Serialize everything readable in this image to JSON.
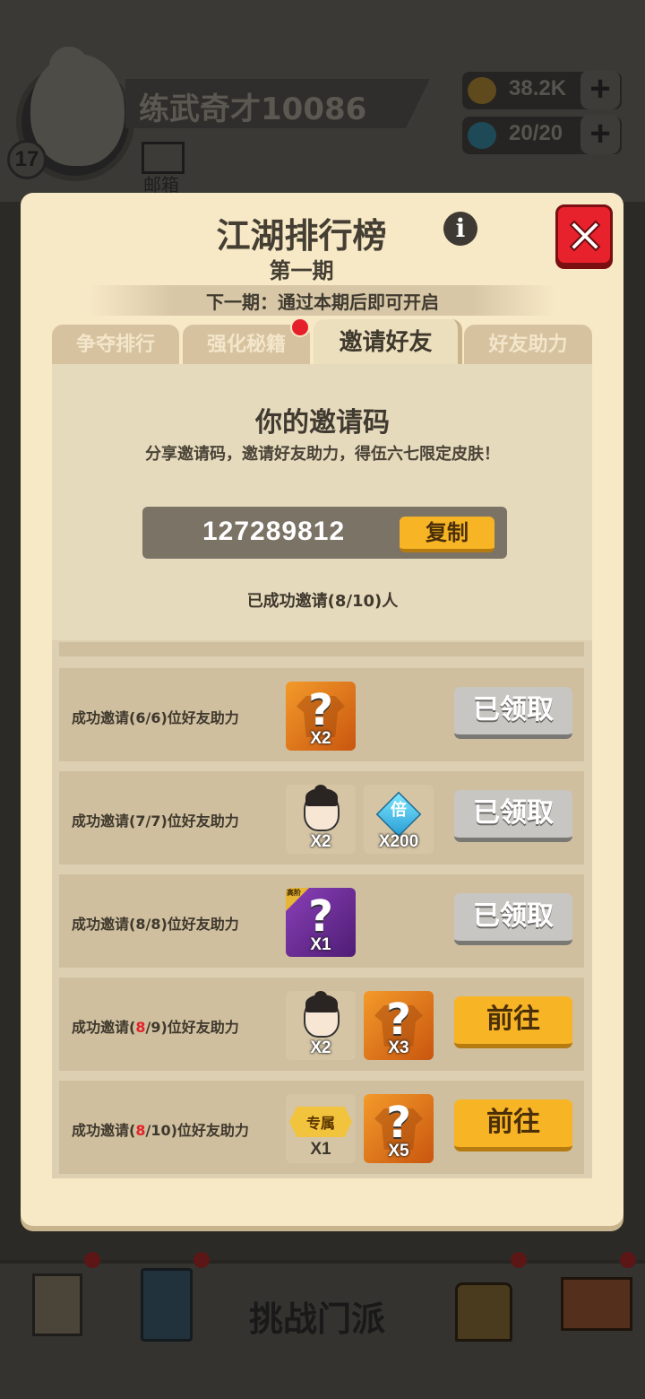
{
  "background": {
    "level": "17",
    "player_name": "练武奇才10086",
    "mail_label": "邮箱",
    "gold": "38.2K",
    "energy": "20/20",
    "plus_symbol": "+",
    "bottom_nav": {
      "challenge_label": "挑战门派"
    }
  },
  "modal": {
    "title": "江湖排行榜",
    "subtitle": "第一期",
    "period_note": "下一期：通过本期后即可开启",
    "tabs": [
      {
        "label": "争夺排行",
        "active": false
      },
      {
        "label": "强化秘籍",
        "active": false
      },
      {
        "label": "邀请好友",
        "active": true
      },
      {
        "label": "好友助力",
        "active": false
      }
    ],
    "invite": {
      "heading": "你的邀请码",
      "description": "分享邀请码，邀请好友助力，得伍六七限定皮肤！",
      "code": "127289812",
      "copy_label": "复制",
      "invited_status": "已成功邀请(8/10)人"
    },
    "rows": [
      {
        "text_prefix": "成功邀请(",
        "progress": "6",
        "text_mid": "/6)位好友助力",
        "rewards": [
          {
            "type": "mystery-outfit",
            "qty": "X2"
          }
        ],
        "button": "已领取",
        "state": "claimed"
      },
      {
        "text_prefix": "成功邀请(",
        "progress": "7",
        "text_mid": "/7)位好友助力",
        "rewards": [
          {
            "type": "character-head",
            "qty": "X2"
          },
          {
            "type": "gem",
            "char": "倍",
            "qty": "X200"
          }
        ],
        "button": "已领取",
        "state": "claimed"
      },
      {
        "text_prefix": "成功邀请(",
        "progress": "8",
        "text_mid": "/8)位好友助力",
        "rewards": [
          {
            "type": "mystery-advanced",
            "tag": "高阶",
            "qty": "X1"
          }
        ],
        "button": "已领取",
        "state": "claimed"
      },
      {
        "text_prefix": "成功邀请(",
        "progress": "8",
        "text_mid": "/9)位好友助力",
        "rewards": [
          {
            "type": "character-head",
            "qty": "X2"
          },
          {
            "type": "mystery-outfit",
            "qty": "X3"
          }
        ],
        "button": "前往",
        "state": "go"
      },
      {
        "text_prefix": "成功邀请(",
        "progress": "8",
        "text_mid": "/10)位好友助力",
        "rewards": [
          {
            "type": "exclusive",
            "label": "专属",
            "qty": "X1"
          },
          {
            "type": "mystery-outfit",
            "qty": "X5"
          }
        ],
        "button": "前往",
        "state": "go"
      }
    ],
    "qmark": "?"
  },
  "colors": {
    "modal_bg": "#f7e8c6",
    "accent_orange": "#f7b425",
    "close_red": "#e8222c",
    "highlight_red": "#e3232b"
  }
}
